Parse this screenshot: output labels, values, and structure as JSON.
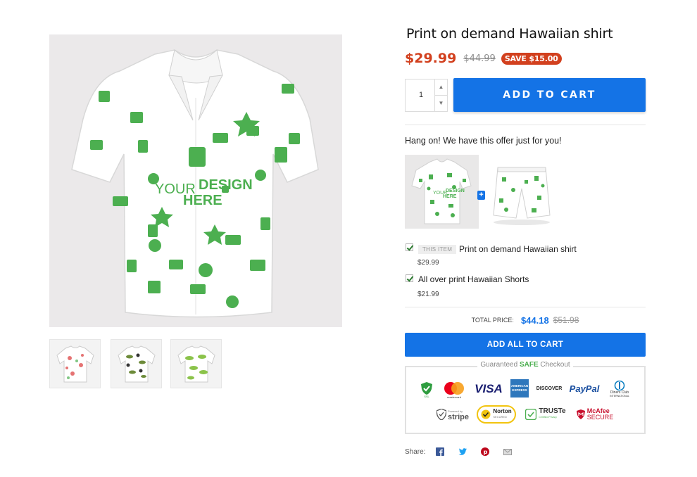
{
  "product": {
    "title": "Print on demand Hawaiian shirt",
    "price": "$29.99",
    "compare_price": "$44.99",
    "save_badge": "SAVE $15.00",
    "quantity": "1",
    "add_to_cart_label": "ADD TO CART",
    "design_text_line1": "YOUR",
    "design_text_line2": "DESIGN",
    "design_text_line3": "HERE",
    "design_color": "#4caf50"
  },
  "gallery": {
    "thumbnails": [
      {
        "name": "flamingo print shirt"
      },
      {
        "name": "toucan palm print shirt"
      },
      {
        "name": "green leaf print shirt"
      }
    ]
  },
  "bundle": {
    "heading": "Hang on! We have this offer just for you!",
    "this_item_tag": "THIS ITEM",
    "items": [
      {
        "name": "Print on demand Hawaiian shirt",
        "price": "$29.99",
        "checked": true
      },
      {
        "name": "All over print Hawaiian Shorts",
        "price": "$21.99",
        "checked": true
      }
    ],
    "total_label": "TOTAL PRICE:",
    "total_price": "$44.18",
    "total_compare": "$51.98",
    "add_all_label": "ADD ALL TO CART"
  },
  "trust": {
    "title_pre": "Guaranteed",
    "title_safe": "SAFE",
    "title_post": "Checkout",
    "badges": {
      "secure_small": "SSL",
      "mastercard": "mastercard",
      "visa": "VISA",
      "amex_line1": "AMERICAN",
      "amex_line2": "EXPRESS",
      "discover": "DISCOVER",
      "paypal": "PayPal",
      "diners_line1": "Diners Club",
      "diners_line2": "INTERNATIONAL",
      "stripe_small": "Powered by",
      "stripe": "stripe",
      "norton": "Norton",
      "norton_small": "SECURED",
      "truste": "TRUSTe",
      "truste_small": "Certified Privacy",
      "mcafee": "McAfee",
      "mcafee_small": "SECURE"
    }
  },
  "share": {
    "label": "Share:",
    "icons": [
      "facebook-icon",
      "twitter-icon",
      "pinterest-icon",
      "email-icon"
    ]
  },
  "colors": {
    "accent": "#1473e6",
    "price": "#d2401e",
    "green": "#4caf50"
  }
}
